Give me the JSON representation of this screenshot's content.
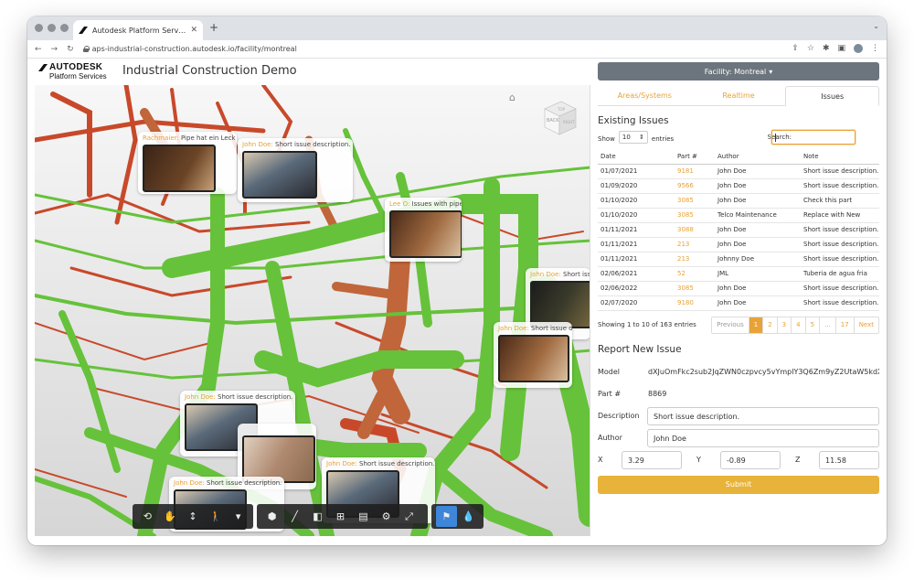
{
  "browser": {
    "tab_title": "Autodesk Platform Services: In...",
    "url": "aps-industrial-construction.autodesk.io/facility/montreal"
  },
  "header": {
    "logo_line1": "AUTODESK",
    "logo_line2": "Platform Services",
    "title": "Industrial Construction Demo"
  },
  "viewer": {
    "viewcube_labels": [
      "BACK",
      "TOP",
      "RIGHT"
    ],
    "issue_notes": [
      {
        "who": "Rachmaier:",
        "desc": " Pipe hat ein Leck"
      },
      {
        "who": "John Doe:",
        "desc": " Short issue description."
      },
      {
        "who": "Lee O:",
        "desc": " Issues with pipe"
      },
      {
        "who": "John Doe:",
        "desc": " Short issue description."
      },
      {
        "who": "John Doe:",
        "desc": " Short issue description."
      },
      {
        "who": "John Doe:",
        "desc": " Short issue description."
      },
      {
        "who": "John Doe:",
        "desc": " Short issue description."
      },
      {
        "who": "John Doe:",
        "desc": " Short issue description."
      }
    ],
    "toolbar_icons": [
      "orbit-icon",
      "pan-icon",
      "dolly-icon",
      "walk-icon",
      "camera-icon",
      "explode-icon",
      "measure-icon",
      "section-icon",
      "model-browser-icon",
      "properties-icon",
      "settings-icon",
      "fullscreen-icon",
      "issues-icon",
      "water-drop-icon"
    ]
  },
  "panel": {
    "facility_button": "Facility: Montreal",
    "tabs": [
      {
        "label": "Areas/Systems",
        "active": false
      },
      {
        "label": "Realtime",
        "active": false
      },
      {
        "label": "Issues",
        "active": true
      }
    ],
    "existing_title": "Existing Issues",
    "show_label": "Show",
    "entries_value": "10",
    "entries_label": "entries",
    "search_label": "Search:",
    "columns": [
      "Date",
      "Part #",
      "Author",
      "Note"
    ],
    "rows": [
      [
        "01/07/2021",
        "9181",
        "John Doe",
        "Short issue description."
      ],
      [
        "01/09/2020",
        "9566",
        "John Doe",
        "Short issue description."
      ],
      [
        "01/10/2020",
        "3085",
        "John Doe",
        "Check this part"
      ],
      [
        "01/10/2020",
        "3085",
        "Telco Maintenance",
        "Replace with New"
      ],
      [
        "01/11/2021",
        "3088",
        "John Doe",
        "Short issue description."
      ],
      [
        "01/11/2021",
        "213",
        "John Doe",
        "Short issue description."
      ],
      [
        "01/11/2021",
        "213",
        "Johnny Doe",
        "Short issue description."
      ],
      [
        "02/06/2021",
        "52",
        "JML",
        "Tuberia de agua fria"
      ],
      [
        "02/06/2022",
        "3085",
        "John Doe",
        "Short issue description."
      ],
      [
        "02/07/2020",
        "9180",
        "John Doe",
        "Short issue description."
      ]
    ],
    "info": "Showing 1 to 10 of 163 entries",
    "pager": [
      "Previous",
      "1",
      "2",
      "3",
      "4",
      "5",
      "...",
      "17",
      "Next"
    ],
    "report_title": "Report New Issue",
    "form": {
      "model_label": "Model",
      "model_value": "dXJuOmFkc2sub2JqZWN0czpvcy5vYmplY3Q6Zm9yZ2UtaW5kdXN0cmlhbC1jb25zdHJ1Y3Rpb24",
      "part_label": "Part #",
      "part_value": "8869",
      "desc_label": "Description",
      "desc_value": "Short issue description.",
      "author_label": "Author",
      "author_value": "John Doe",
      "x_label": "X",
      "x_value": "3.29",
      "y_label": "Y",
      "y_value": "-0.89",
      "z_label": "Z",
      "z_value": "11.58",
      "submit": "Submit"
    }
  },
  "colors": {
    "accent": "#e8a236",
    "pipe_green": "#66c23a",
    "pipe_red": "#c8492a",
    "pipe_orange": "#c0663a",
    "toolbar_active": "#3d86d8"
  }
}
